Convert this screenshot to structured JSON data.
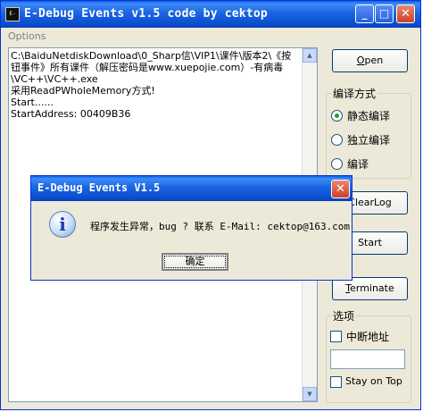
{
  "window": {
    "title": "E-Debug Events v1.5 code by cektop",
    "icon_text": "E-Debug",
    "minimize": "_",
    "maximize": "□",
    "close": "✕"
  },
  "menu": {
    "options": "Options"
  },
  "log": {
    "lines": [
      "C:\\BaiduNetdiskDownload\\0_Sharp信\\VIP1\\课件\\版本2\\《按",
      "钮事件》所有课件（解压密码是www.xuepojie.com）-有病毒",
      "\\VC++\\VC++.exe",
      "采用ReadPWholeMemory方式!",
      "Start......",
      "StartAddress: 00409B36"
    ]
  },
  "buttons": {
    "open": {
      "first": "O",
      "rest": "pen"
    },
    "clearlog": "ClearLog",
    "start": "Start",
    "terminate": {
      "first": "T",
      "rest": "erminate"
    }
  },
  "compile_group": {
    "label": "编译方式",
    "options": [
      {
        "label": "静态编译",
        "checked": true
      },
      {
        "label": "独立编译",
        "checked": false
      },
      {
        "label": "编译",
        "checked": false
      }
    ]
  },
  "options_group": {
    "label": "选项",
    "interrupt_label": "中断地址",
    "interrupt_value": "",
    "stay_on_top": "Stay on Top"
  },
  "dialog": {
    "title": "E-Debug Events V1.5",
    "close": "✕",
    "icon": "i",
    "message": "程序发生异常，bug ? 联系 E-Mail: cektop@163.com",
    "ok": "确定"
  },
  "scrollbar": {
    "up": "▲",
    "down": "▼"
  }
}
